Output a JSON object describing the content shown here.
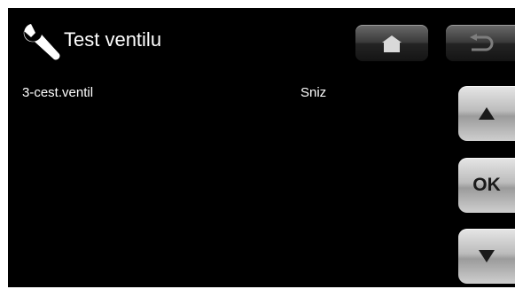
{
  "header": {
    "icon": "wrench-icon",
    "title": "Test ventilu"
  },
  "toolbar": {
    "home_icon": "home-icon",
    "back_icon": "back-arrow-icon"
  },
  "rows": [
    {
      "label": "3-cest.ventil",
      "value": "Sniz"
    }
  ],
  "side_buttons": {
    "up_icon": "triangle-up-icon",
    "ok_label": "OK",
    "down_icon": "triangle-down-icon"
  },
  "colors": {
    "screen_background": "#000000",
    "text": "#ffffff"
  }
}
